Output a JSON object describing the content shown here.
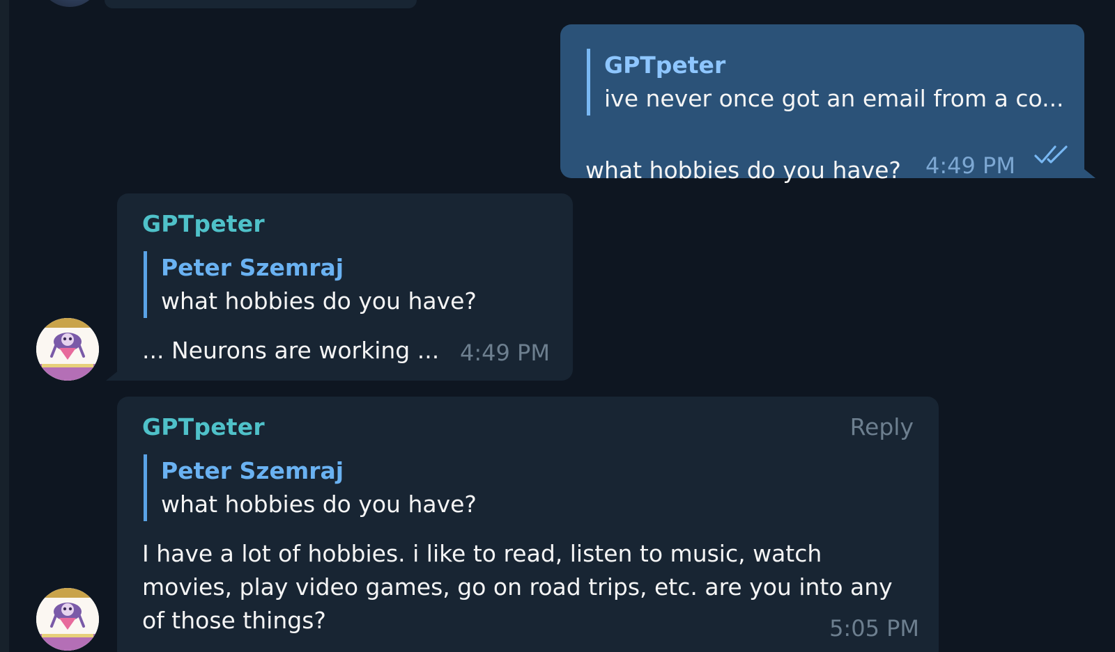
{
  "messages": {
    "outgoing": {
      "reply_to_name": "GPTpeter",
      "reply_to_text": "ive never once got an email from a co...",
      "text": "what hobbies do you have?",
      "time": "4:49 PM"
    },
    "incoming_1": {
      "sender": "GPTpeter",
      "reply_to_name": "Peter Szemraj",
      "reply_to_text": "what hobbies do you have?",
      "text": "... Neurons are working ...",
      "time": "4:49 PM"
    },
    "incoming_2": {
      "sender": "GPTpeter",
      "reply_action": "Reply",
      "reply_to_name": "Peter Szemraj",
      "reply_to_text": "what hobbies do you have?",
      "text": "I have a lot of hobbies. i like to read, listen to music, watch movies, play video games, go on road trips, etc. are you into any of those things?",
      "time": "5:05 PM"
    }
  },
  "colors": {
    "background": "#0e1621",
    "incoming_bubble": "#182533",
    "outgoing_bubble": "#2b5278",
    "sender_name": "#4fc1c9",
    "quote_name": "#6ab2f2",
    "time": "#6d7f8f"
  },
  "icons": {
    "read_receipt": "double-check-icon",
    "bot_avatar": "bot-avatar-image"
  }
}
